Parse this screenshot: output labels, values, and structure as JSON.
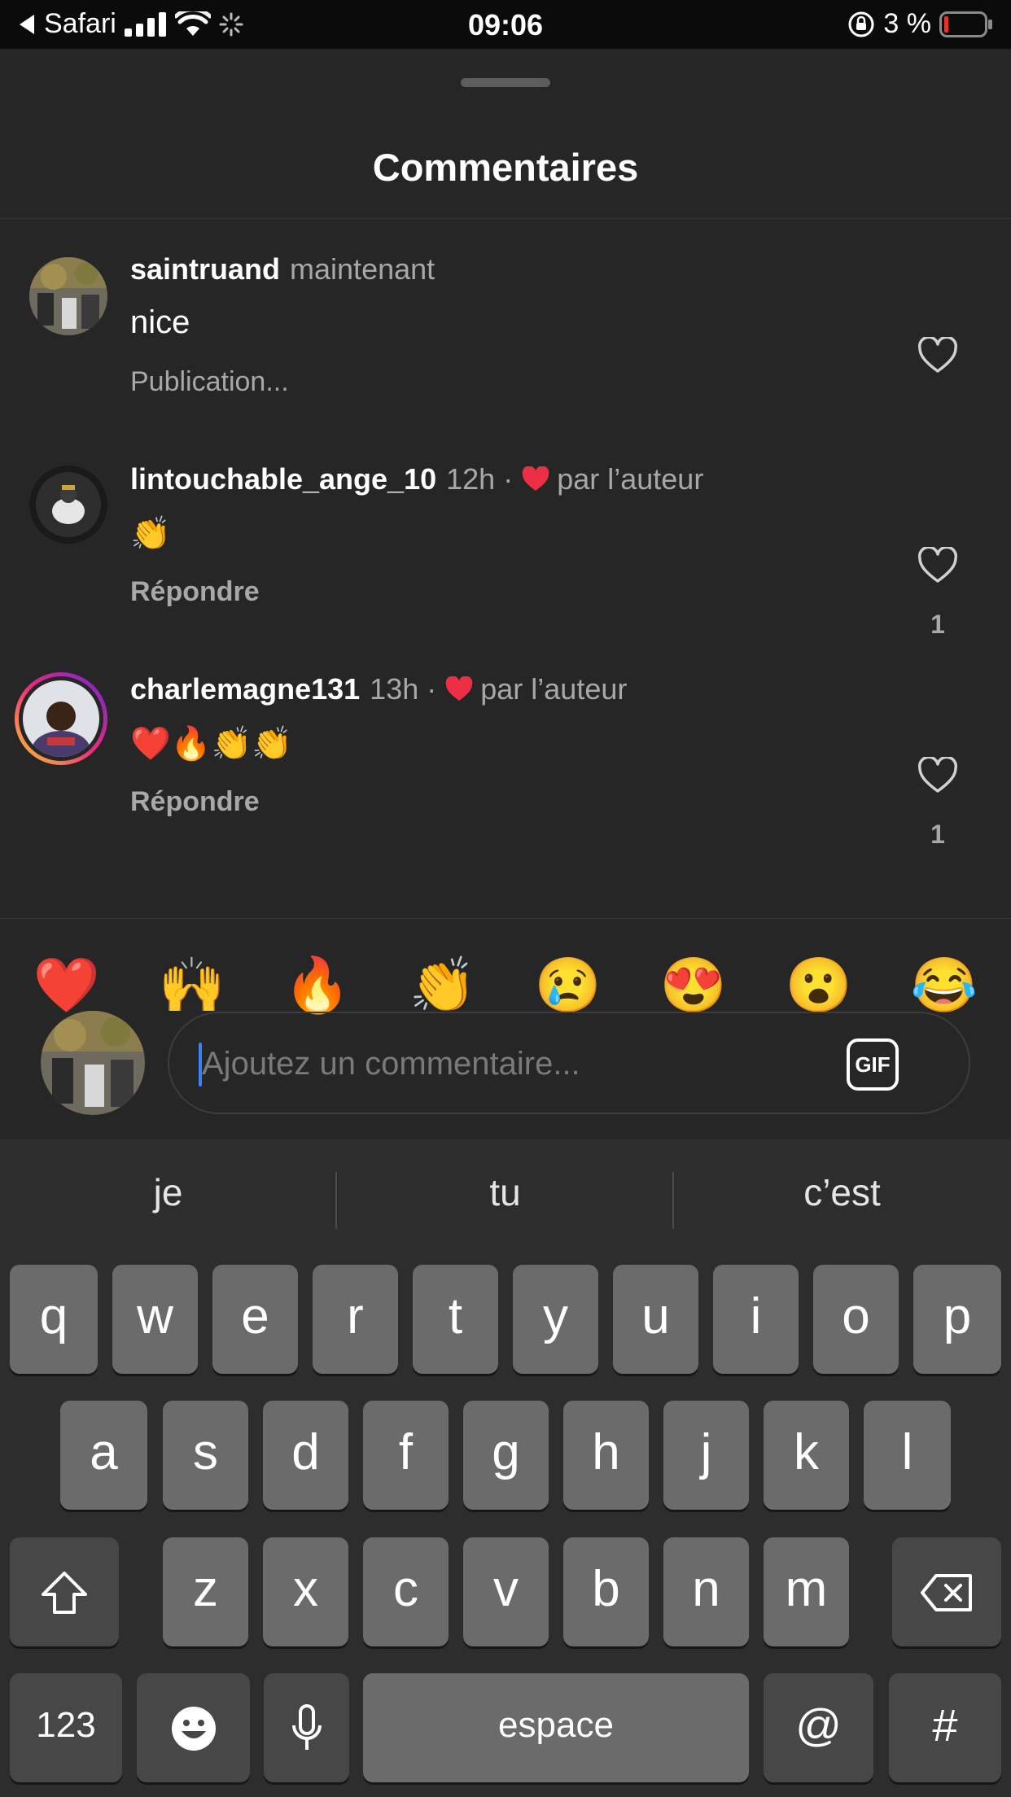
{
  "status_bar": {
    "back_app": "Safari",
    "time": "09:06",
    "battery_percent": "3 %"
  },
  "sheet": {
    "title": "Commentaires"
  },
  "comments": [
    {
      "username": "saintruand",
      "time": "maintenant",
      "liked_by_author": false,
      "author_label": "",
      "text": "nice",
      "action": "Publication...",
      "likes": ""
    },
    {
      "username": "lintouchable_ange_10",
      "time": "12h",
      "liked_by_author": true,
      "author_label": "par l’auteur",
      "text": "👏",
      "action": "Répondre",
      "likes": "1"
    },
    {
      "username": "charlemagne131",
      "time": "13h",
      "liked_by_author": true,
      "author_label": "par l’auteur",
      "text": "❤️🔥👏👏",
      "action": "Répondre",
      "likes": "1"
    }
  ],
  "reactions": [
    "❤️",
    "🙌",
    "🔥",
    "👏",
    "😢",
    "😍",
    "😮",
    "😂"
  ],
  "composer": {
    "placeholder": "Ajoutez un commentaire...",
    "value": "",
    "gif_label": "GIF"
  },
  "keyboard": {
    "suggestions": [
      "je",
      "tu",
      "c’est"
    ],
    "row1": [
      "q",
      "w",
      "e",
      "r",
      "t",
      "y",
      "u",
      "i",
      "o",
      "p"
    ],
    "row2": [
      "a",
      "s",
      "d",
      "f",
      "g",
      "h",
      "j",
      "k",
      "l"
    ],
    "row3": [
      "z",
      "x",
      "c",
      "v",
      "b",
      "n",
      "m"
    ],
    "numbers_label": "123",
    "space_label": "espace",
    "at_label": "@",
    "hash_label": "#"
  },
  "icons": {
    "status": [
      "back-arrow-icon",
      "signal-icon",
      "wifi-icon",
      "loading-spinner-icon",
      "orientation-lock-icon",
      "battery-icon"
    ],
    "comments": [
      "heart-outline-icon",
      "heart-filled-icon"
    ],
    "keyboard": [
      "shift-icon",
      "backspace-icon",
      "emoji-icon",
      "microphone-icon"
    ]
  },
  "colors": {
    "background": "#262626",
    "author_heart": "#ed2f45",
    "caret": "#3b82f6",
    "battery_low": "#e5352b"
  }
}
